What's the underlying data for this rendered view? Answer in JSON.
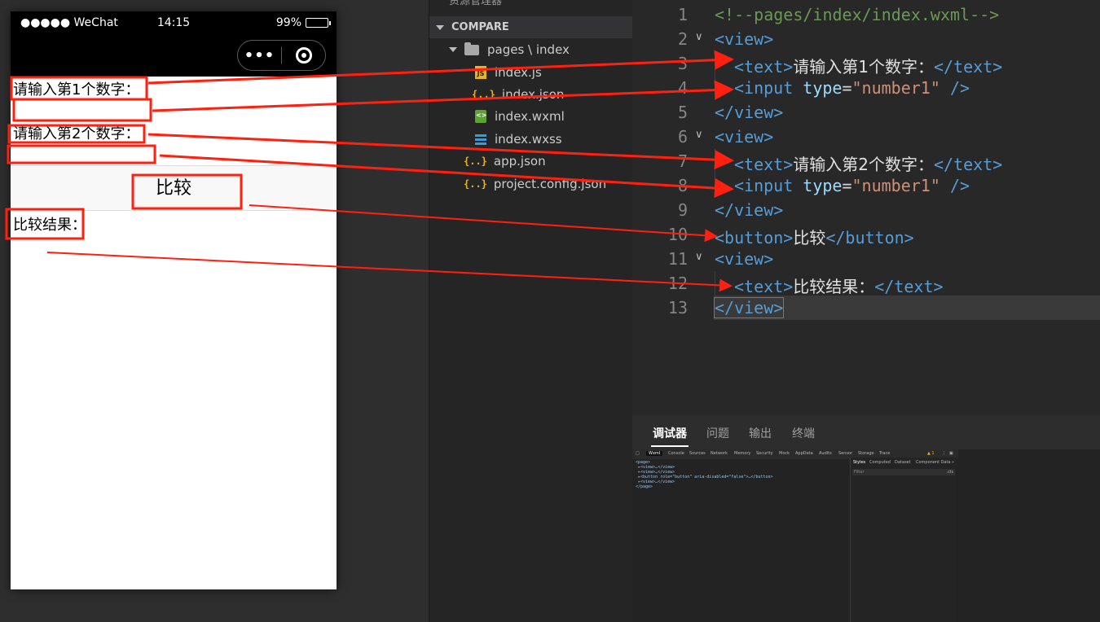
{
  "simulator": {
    "status_bar": {
      "carrier": "●●●●● WeChat",
      "time": "14:15",
      "battery": "99%",
      "battery_level": 0.99
    },
    "capsule": {
      "more": "•••"
    },
    "page": {
      "label1": "请输入第1个数字：",
      "label2": "请输入第2个数字：",
      "button": "比较",
      "result": "比较结果："
    }
  },
  "explorer": {
    "header_cut": "资源管理器",
    "section": "COMPARE",
    "folder": "pages \\ index",
    "files": [
      "index.js",
      "index.json",
      "index.wxml",
      "index.wxss"
    ],
    "root_files": [
      "app.json",
      "project.config.json"
    ]
  },
  "editor": {
    "line_numbers": [
      "1",
      "2",
      "3",
      "4",
      "5",
      "6",
      "7",
      "8",
      "9",
      "10",
      "11",
      "12",
      "13"
    ],
    "line1": "<!--pages/index/index.wxml-->",
    "open_view": "<view>",
    "close_view": "</view>",
    "open_text": "<text>",
    "close_text": "</text>",
    "input_open": "<input",
    "type_attr": "type",
    "eq": "=",
    "type_val": "\"number1\"",
    "self_close": "/>",
    "label1": "请输入第1个数字：",
    "label2": "请输入第2个数字：",
    "open_button": "<button>",
    "close_button": "</button>",
    "button_text": "比较",
    "result_text": "比较结果："
  },
  "debugger": {
    "tabs": [
      "调试器",
      "问题",
      "输出",
      "终端"
    ],
    "devtools_tabs": [
      "Wxml",
      "Console",
      "Sources",
      "Network",
      "Memory",
      "Security",
      "Mock",
      "AppData",
      "Audits",
      "Sensor",
      "Storage",
      "Trace"
    ],
    "warning": "▲ 1",
    "tree": [
      "<page>",
      "▸<view>…</view>",
      "▸<view>…</view>",
      "▸<button role=\"button\" aria-disabled=\"false\">…</button>",
      "▸<view>…</view>",
      "</page>"
    ],
    "style_tabs": [
      "Styles",
      "Computed",
      "Dataset",
      "Component Data"
    ],
    "filter": "Filter",
    "cls": ".cls"
  },
  "colors": {
    "arrow": "#ff2010",
    "tag": "#569cd6",
    "comment": "#6a9955",
    "string": "#ce9178",
    "attribute": "#9cdcfe"
  }
}
